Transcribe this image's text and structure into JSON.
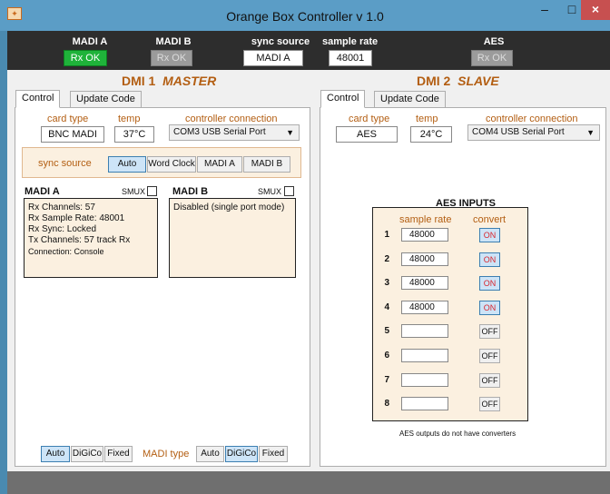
{
  "window": {
    "title": "Orange Box Controller v 1.0",
    "icon": "orange-box-icon",
    "minimize": "–",
    "maximize": "□",
    "close": "×"
  },
  "status": {
    "madi_a": {
      "label": "MADI A",
      "state": "Rx OK"
    },
    "madi_b": {
      "label": "MADI B",
      "state": "Rx OK"
    },
    "sync_source": {
      "label": "sync source",
      "value": "MADI A"
    },
    "sample_rate": {
      "label": "sample rate",
      "value": "48001"
    },
    "aes": {
      "label": "AES",
      "state": "Rx OK"
    },
    "colors": {
      "led_on": "#1fb33a",
      "led_off": "#9b9b9b",
      "strip": "#2d2d2d"
    }
  },
  "dmi1": {
    "title": "DMI 1",
    "role": "MASTER",
    "tabs": [
      "Control",
      "Update Code"
    ],
    "card_type_label": "card type",
    "card_type": "BNC MADI",
    "temp_label": "temp",
    "temp": "37°C",
    "controller_label": "controller connection",
    "controller": "COM3 USB Serial Port",
    "sync_label": "sync source",
    "sync_buttons": [
      "Auto",
      "Word Clock",
      "MADI A",
      "MADI B"
    ],
    "madi_a": {
      "title": "MADI A",
      "smux": "SMUX",
      "lines": [
        "Rx Channels: 57",
        "Rx Sample Rate: 48001",
        "Rx Sync: Locked",
        "Tx Channels: 57  track Rx",
        "Connection: Console"
      ]
    },
    "madi_b": {
      "title": "MADI B",
      "smux": "SMUX",
      "lines": [
        "Disabled (single port mode)"
      ]
    },
    "left_mode_buttons": [
      "Auto",
      "DiGiCo",
      "Fixed"
    ],
    "madi_type_label": "MADI type",
    "right_mode_buttons": [
      "Auto",
      "DiGiCo",
      "Fixed"
    ]
  },
  "dmi2": {
    "title": "DMI 2",
    "role": "SLAVE",
    "tabs": [
      "Control",
      "Update Code"
    ],
    "card_type_label": "card type",
    "card_type": "AES",
    "temp_label": "temp",
    "temp": "24°C",
    "controller_label": "controller connection",
    "controller": "COM4 USB Serial Port",
    "aes_inputs": {
      "title": "AES INPUTS",
      "col_rate": "sample rate",
      "col_convert": "convert",
      "rows": [
        {
          "n": "1",
          "rate": "48000",
          "convert": "ON"
        },
        {
          "n": "2",
          "rate": "48000",
          "convert": "ON"
        },
        {
          "n": "3",
          "rate": "48000",
          "convert": "ON"
        },
        {
          "n": "4",
          "rate": "48000",
          "convert": "ON"
        },
        {
          "n": "5",
          "rate": "",
          "convert": "OFF"
        },
        {
          "n": "6",
          "rate": "",
          "convert": "OFF"
        },
        {
          "n": "7",
          "rate": "",
          "convert": "OFF"
        },
        {
          "n": "8",
          "rate": "",
          "convert": "OFF"
        }
      ]
    },
    "aes_note": "AES outputs do not have converters"
  }
}
